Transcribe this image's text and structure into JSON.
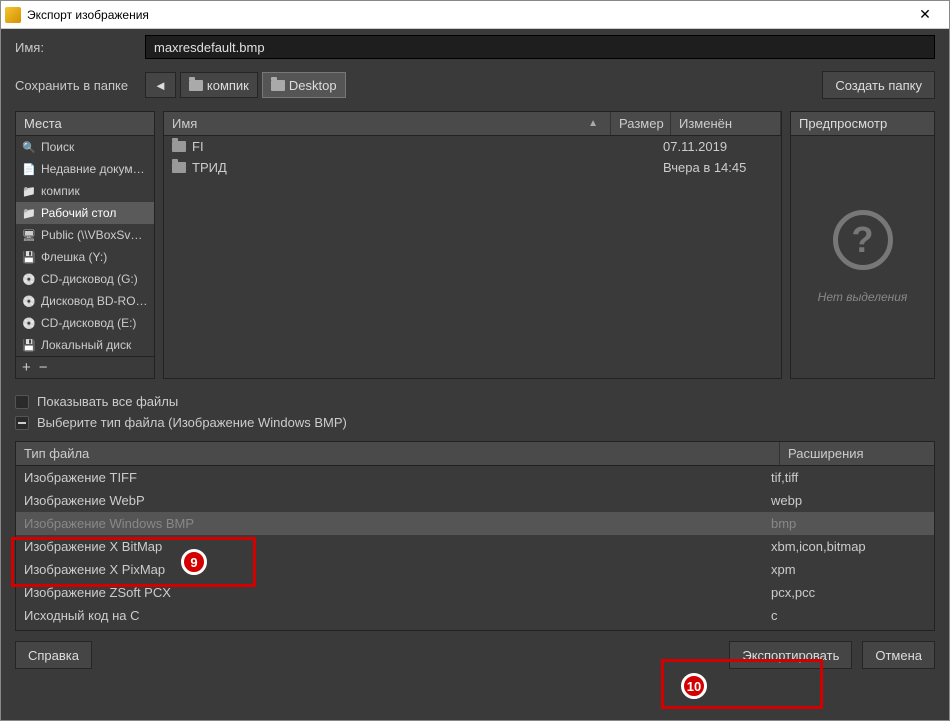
{
  "window": {
    "title": "Экспорт изображения"
  },
  "name_row": {
    "label": "Имя:",
    "value": "maxresdefault.bmp"
  },
  "path_row": {
    "label": "Сохранить в папке",
    "crumbs": [
      {
        "label": "компик",
        "active": false
      },
      {
        "label": "Desktop",
        "active": true
      }
    ],
    "create_folder": "Создать папку"
  },
  "places": {
    "header": "Места",
    "items": [
      {
        "label": "Поиск",
        "icon": "ic-search"
      },
      {
        "label": "Недавние докум…",
        "icon": "ic-doc"
      },
      {
        "label": "компик",
        "icon": "ic-folder"
      },
      {
        "label": "Рабочий стол",
        "icon": "ic-folder",
        "selected": true
      },
      {
        "label": "Public (\\\\VBoxSv…",
        "icon": "ic-net"
      },
      {
        "label": "Флешка (Y:)",
        "icon": "ic-drive"
      },
      {
        "label": "CD-дисковод (G:)",
        "icon": "ic-cd"
      },
      {
        "label": "Дисковод BD-RO…",
        "icon": "ic-cd"
      },
      {
        "label": "CD-дисковод (E:)",
        "icon": "ic-cd"
      },
      {
        "label": "Локальный диск",
        "icon": "ic-drive"
      }
    ]
  },
  "filelist": {
    "headers": {
      "name": "Имя",
      "size": "Размер",
      "modified": "Изменён"
    },
    "rows": [
      {
        "name": "FI",
        "size": "",
        "modified": "07.11.2019"
      },
      {
        "name": "ТРИД",
        "size": "",
        "modified": "Вчера в 14:45"
      }
    ]
  },
  "preview": {
    "header": "Предпросмотр",
    "no_selection": "Нет выделения"
  },
  "options": {
    "show_all": "Показывать все файлы",
    "select_type": "Выберите тип файла (Изображение Windows BMP)"
  },
  "type_table": {
    "headers": {
      "type": "Тип файла",
      "ext": "Расширения"
    },
    "rows": [
      {
        "type": "Изображение TIFF",
        "ext": "tif,tiff"
      },
      {
        "type": "Изображение WebP",
        "ext": "webp"
      },
      {
        "type": "Изображение Windows BMP",
        "ext": "bmp",
        "selected": true
      },
      {
        "type": "Изображение X BitMap",
        "ext": "xbm,icon,bitmap"
      },
      {
        "type": "Изображение X PixMap",
        "ext": "xpm"
      },
      {
        "type": "Изображение ZSoft PCX",
        "ext": "pcx,pcc"
      },
      {
        "type": "Исходный код на C",
        "ext": "c"
      }
    ]
  },
  "buttons": {
    "help": "Справка",
    "export": "Экспортировать",
    "cancel": "Отмена"
  },
  "annotations": {
    "n9": "9",
    "n10": "10"
  }
}
